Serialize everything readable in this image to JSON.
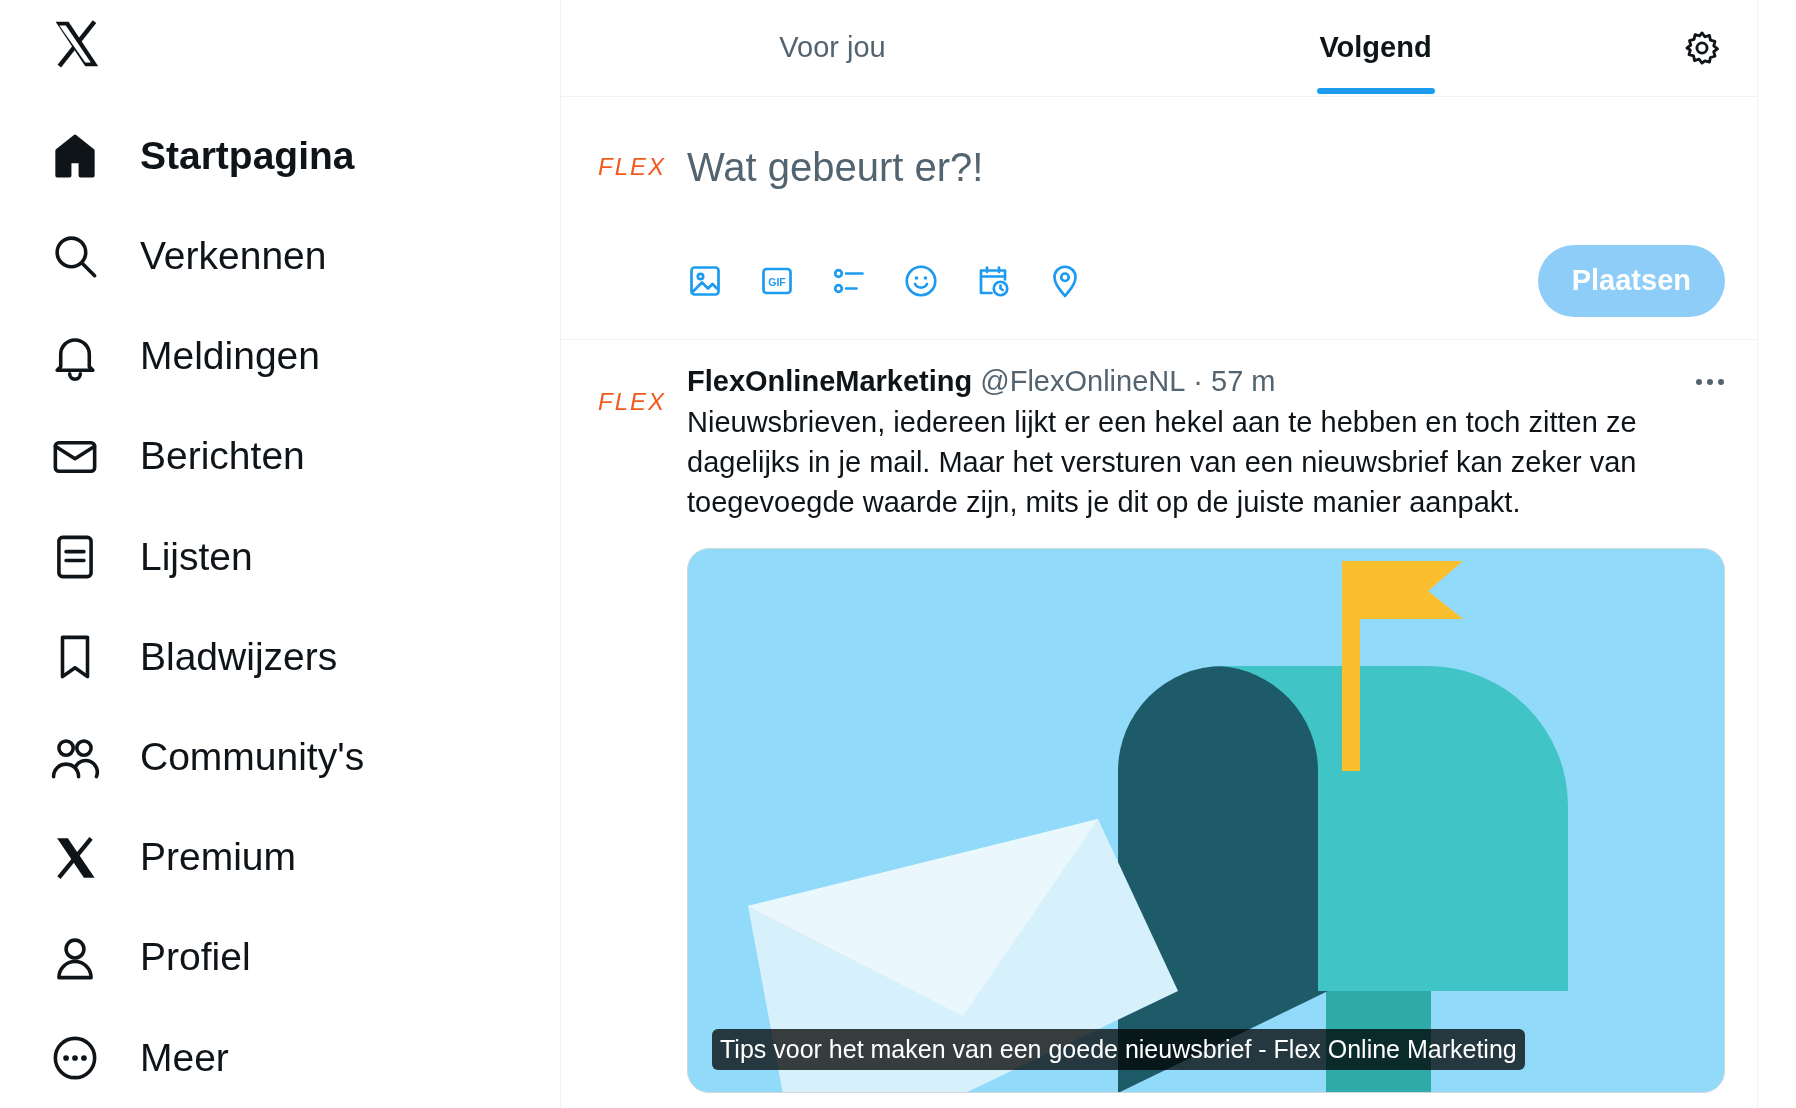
{
  "sidebar": {
    "items": [
      {
        "kind": "home",
        "label": "Startpagina",
        "selected": true
      },
      {
        "kind": "search",
        "label": "Verkennen",
        "selected": false
      },
      {
        "kind": "bell",
        "label": "Meldingen",
        "selected": false
      },
      {
        "kind": "mail",
        "label": "Berichten",
        "selected": false
      },
      {
        "kind": "list",
        "label": "Lijsten",
        "selected": false
      },
      {
        "kind": "bookmark",
        "label": "Bladwijzers",
        "selected": false
      },
      {
        "kind": "people",
        "label": "Community's",
        "selected": false
      },
      {
        "kind": "x",
        "label": "Premium",
        "selected": false
      },
      {
        "kind": "person",
        "label": "Profiel",
        "selected": false
      },
      {
        "kind": "more",
        "label": "Meer",
        "selected": false
      }
    ]
  },
  "tabs": [
    {
      "label": "Voor jou",
      "selected": false
    },
    {
      "label": "Volgend",
      "selected": true
    }
  ],
  "composer": {
    "avatar": "FLEX",
    "placeholder": "Wat gebeurt er?!",
    "tools": [
      {
        "kind": "image"
      },
      {
        "kind": "gif",
        "label": "GIF"
      },
      {
        "kind": "poll"
      },
      {
        "kind": "emoji"
      },
      {
        "kind": "schedule"
      },
      {
        "kind": "location"
      }
    ],
    "post_button": "Plaatsen",
    "post_disabled": true
  },
  "posts": [
    {
      "avatar": "FLEX",
      "name": "FlexOnlineMarketing",
      "handle": "@FlexOnlineNL",
      "separator": "·",
      "time": "57 m",
      "text": "Nieuwsbrieven, iedereen lijkt er een hekel aan te hebben en toch zitten ze dagelijks in je mail. Maar het versturen van een nieuwsbrief kan zeker van toegevoegde waarde zijn, mits je dit op de juiste manier aanpakt.",
      "card_caption": "Tips voor het maken van een goede nieuwsbrief - Flex Online Marketing"
    }
  ]
}
